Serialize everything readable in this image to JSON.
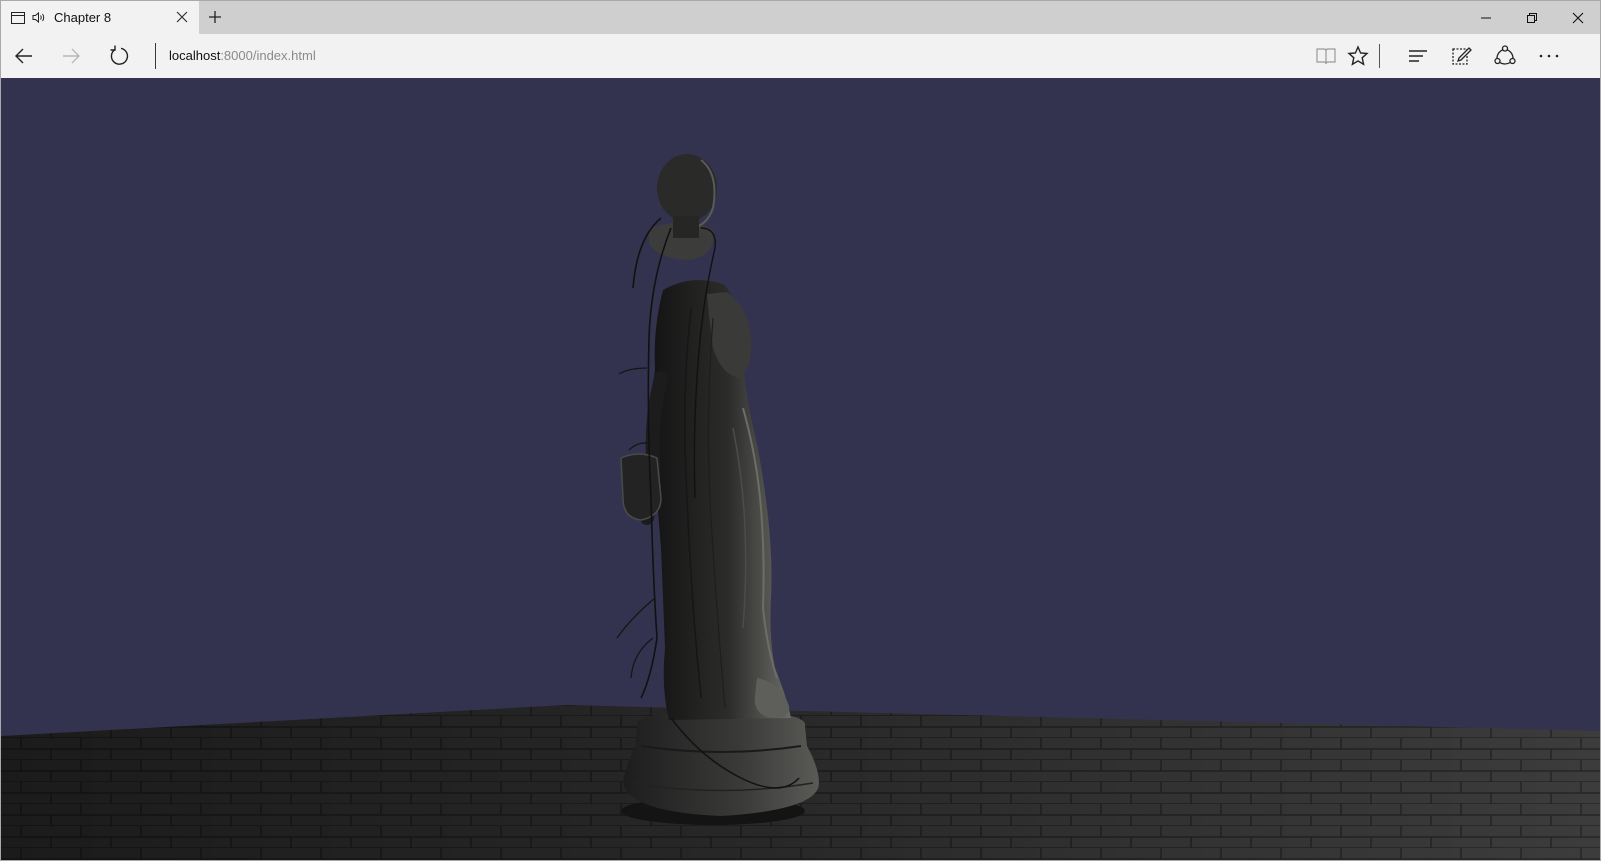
{
  "tab": {
    "title": "Chapter 8",
    "page_icon": "page-icon",
    "audio_icon": "speaker-icon",
    "close_icon": "close-icon"
  },
  "titlebar": {
    "new_tab_icon": "plus-icon",
    "minimize_icon": "minimize-icon",
    "restore_icon": "restore-icon",
    "close_icon": "close-icon"
  },
  "navbar": {
    "back_icon": "arrow-left-icon",
    "forward_icon": "arrow-right-icon",
    "refresh_icon": "refresh-icon",
    "address_host": "localhost",
    "address_rest": ":8000/index.html",
    "reading_view_icon": "book-icon",
    "favorite_icon": "star-icon",
    "hub_icon": "hub-icon",
    "web_note_icon": "pen-note-icon",
    "share_icon": "share-icon",
    "more_icon": "more-icon"
  },
  "scene": {
    "background_color": "#33334f",
    "floor_color": "#3e3e3e",
    "statue_color": "#4a4a48",
    "description_object": "statue"
  }
}
